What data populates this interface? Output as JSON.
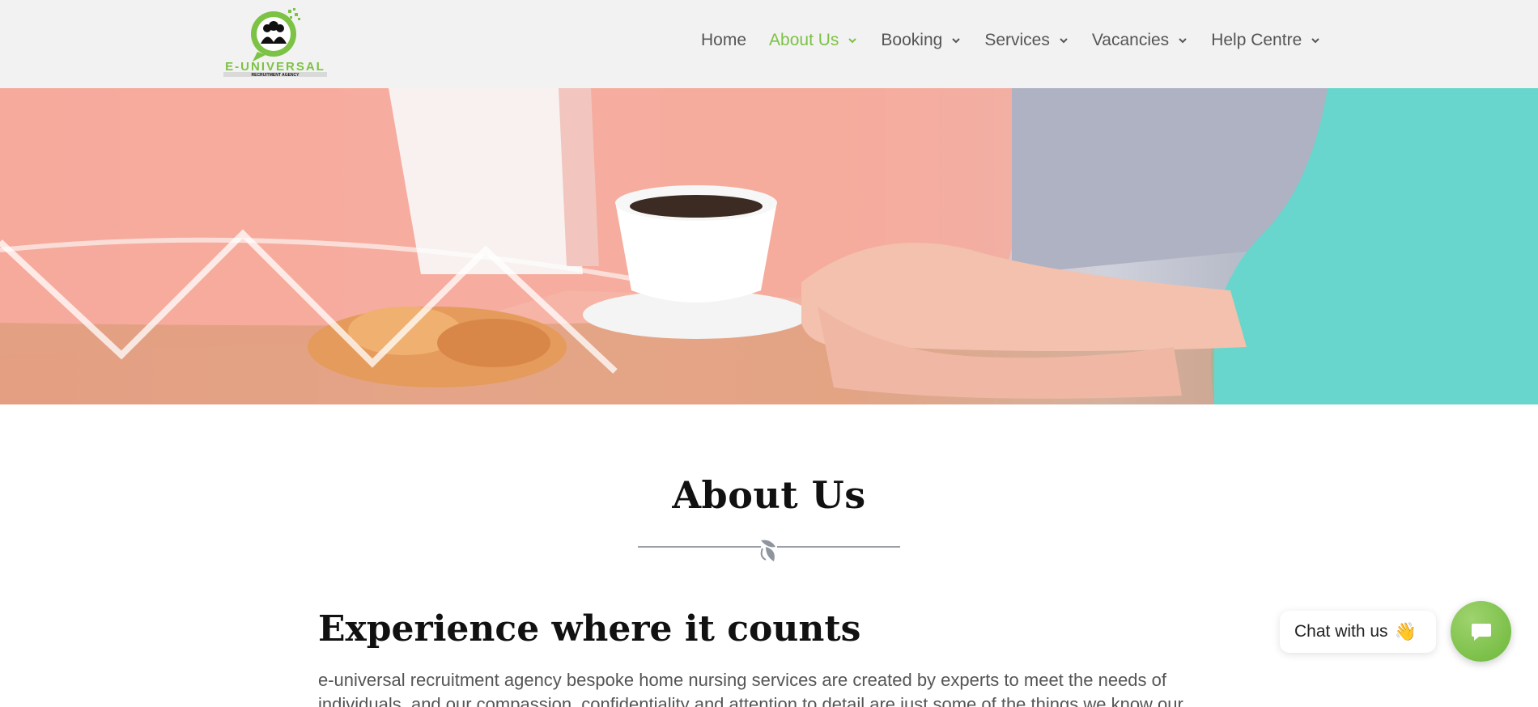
{
  "header": {
    "logo": {
      "brand": "E-UNIVERSAL",
      "tagline": "RECRUITMENT AGENCY",
      "icon": "people-chat-icon",
      "brand_color": "#7cc244"
    },
    "nav": [
      {
        "label": "Home",
        "has_dropdown": false,
        "active": false
      },
      {
        "label": "About Us",
        "has_dropdown": true,
        "active": true
      },
      {
        "label": "Booking",
        "has_dropdown": true,
        "active": false
      },
      {
        "label": "Services",
        "has_dropdown": true,
        "active": false
      },
      {
        "label": "Vacancies",
        "has_dropdown": true,
        "active": false
      },
      {
        "label": "Help Centre",
        "has_dropdown": true,
        "active": false
      }
    ],
    "accent_color": "#7cc244"
  },
  "hero": {
    "image": "hero-photo-caregiver-holding-hands"
  },
  "main": {
    "title": "About Us",
    "divider_icon": "ornament-leaf-icon",
    "heading": "Experience where it counts",
    "body": "e-universal recruitment agency bespoke home nursing services are created by experts to meet the needs of individuals, and our compassion, confidentiality and attention to detail are just some of the things we know our clients value. We"
  },
  "chat": {
    "label": "Chat with us",
    "emoji": "👋",
    "button_icon": "chat-icon",
    "button_color": "#7cc244"
  }
}
